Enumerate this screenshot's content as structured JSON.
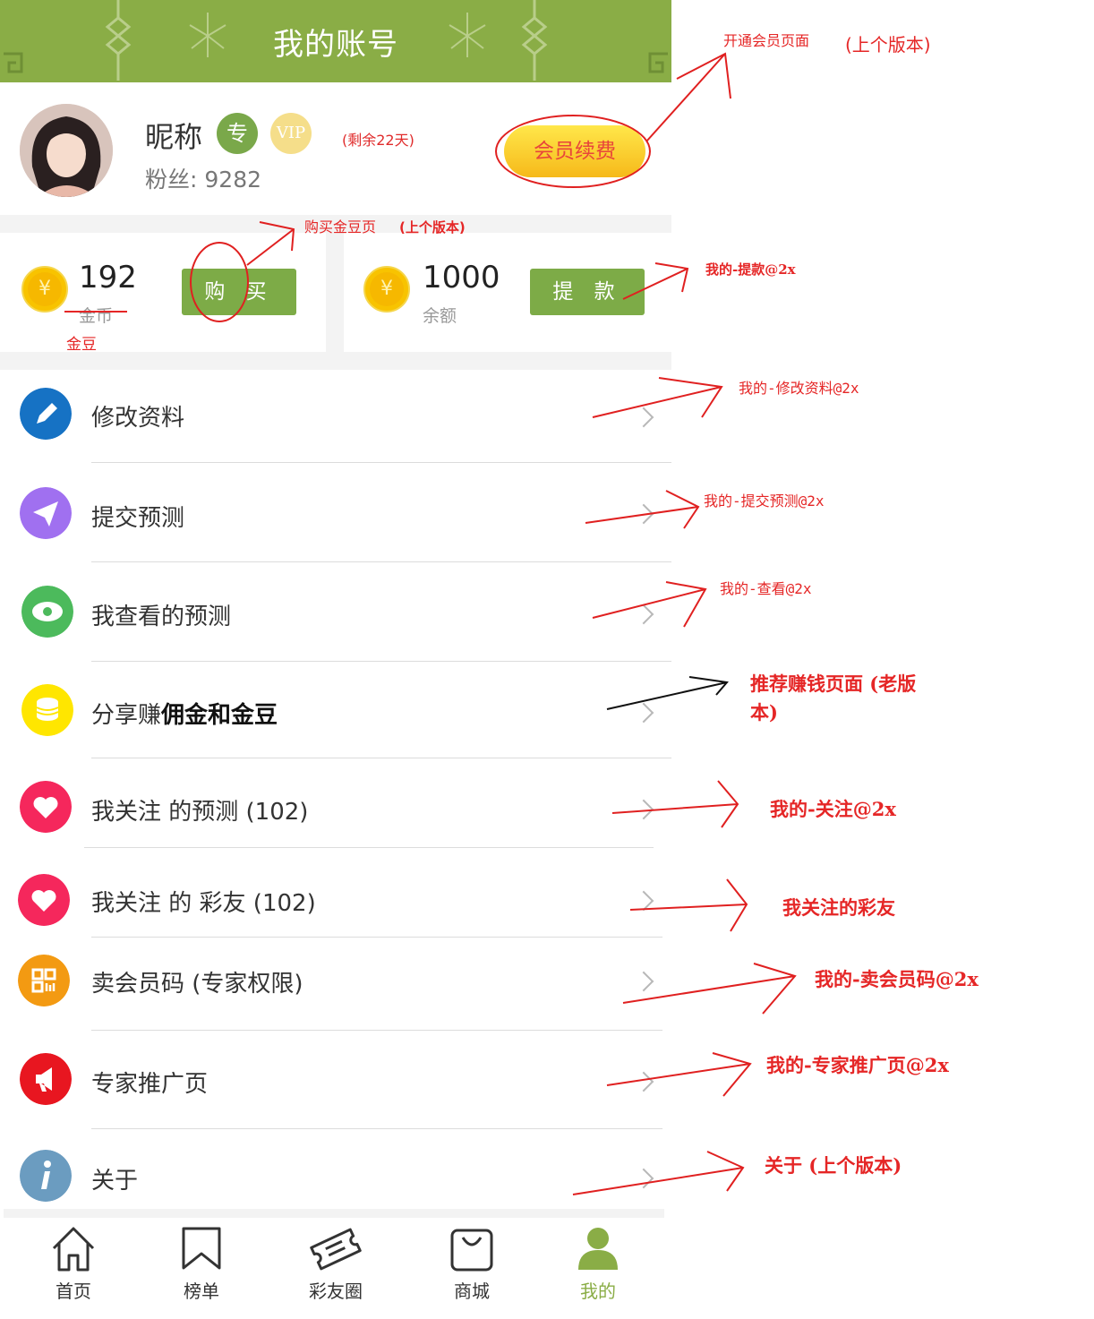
{
  "header": {
    "title": "我的账号"
  },
  "profile": {
    "nickname": "昵称",
    "badge_expert": "专",
    "badge_vip": "VIP",
    "remaining": "(剩余22天)",
    "fans_label": "粉丝:",
    "fans_count": "9282",
    "renew_button": "会员续费"
  },
  "wallet": {
    "coins": {
      "icon": "yen-coin-icon",
      "amount": "192",
      "label_struck": "金币",
      "label_new": "金豆",
      "button": "购 买"
    },
    "balance": {
      "icon": "yen-coin-icon",
      "amount": "1000",
      "label": "余额",
      "button": "提 款"
    }
  },
  "menu": [
    {
      "label": "修改资料",
      "icon": "pencil-icon",
      "color": "#1672c4"
    },
    {
      "label": "提交预测",
      "icon": "paper-plane-icon",
      "color": "#a070f0"
    },
    {
      "label": "我查看的预测",
      "icon": "eye-icon",
      "color": "#4cba5c"
    },
    {
      "label": "分享赚",
      "label_extra": "佣金和金豆",
      "icon": "coin-stack-icon",
      "color": "#ffe600"
    },
    {
      "label": "我关注 的预测 (102)",
      "icon": "heart-icon",
      "color": "#f5275c"
    },
    {
      "label": "我关注 的 彩友 (102)",
      "icon": "heart-icon",
      "color": "#f5275c"
    },
    {
      "label": "卖会员码 (专家权限)",
      "icon": "qr-code-icon",
      "color": "#f39a12"
    },
    {
      "label": "专家推广页",
      "icon": "megaphone-icon",
      "color": "#e81620"
    },
    {
      "label": "关于",
      "icon": "info-icon",
      "color": "#6b9cc0"
    }
  ],
  "annotations": {
    "member_page": "开通会员页面",
    "member_page_version": "(上个版本)",
    "buy_beans": "购买金豆页",
    "buy_beans_version": "(上个版本)",
    "withdraw": "我的-提款@2x",
    "edit_profile": "我的-修改资料@2x",
    "submit_prediction": "我的-提交预测@2x",
    "viewed": "我的-查看@2x",
    "share_earn_line1": "推荐赚钱页面 (老版",
    "share_earn_line2": "本)",
    "follow": "我的-关注@2x",
    "followed_friends": "我关注的彩友",
    "sell_code": "我的-卖会员码@2x",
    "promo": "我的-专家推广页@2x",
    "about": "关于 (上个版本)"
  },
  "tabbar": [
    {
      "label": "首页",
      "icon": "home-icon",
      "active": false
    },
    {
      "label": "榜单",
      "icon": "bookmark-icon",
      "active": false
    },
    {
      "label": "彩友圈",
      "icon": "ticket-icon",
      "active": false
    },
    {
      "label": "商城",
      "icon": "shopping-bag-icon",
      "active": false
    },
    {
      "label": "我的",
      "icon": "person-icon",
      "active": true
    }
  ],
  "colors": {
    "brand_green": "#8aad46",
    "button_green": "#7dab47",
    "annotation_red": "#e52626",
    "gold": "#f6b800"
  }
}
